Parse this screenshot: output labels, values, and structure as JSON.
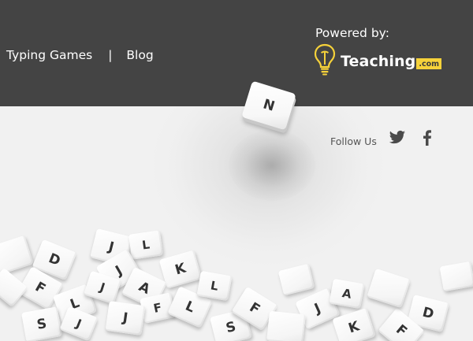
{
  "header": {
    "nav": {
      "typing_games": "Typing Games",
      "separator": "|",
      "blog": "Blog"
    },
    "powered_by": "Powered by:",
    "brand": {
      "name": "Teaching",
      "suffix": ".com",
      "icon": "lightbulb-icon"
    }
  },
  "flying_tile": "N",
  "follow": {
    "label": "Follow Us",
    "icons": [
      "twitter-icon",
      "facebook-icon"
    ]
  },
  "tiles": [
    {
      "letter": ""
    },
    {
      "letter": "D"
    },
    {
      "letter": "J"
    },
    {
      "letter": "L"
    },
    {
      "letter": "J"
    },
    {
      "letter": "K"
    },
    {
      "letter": "F"
    },
    {
      "letter": "L"
    },
    {
      "letter": "J"
    },
    {
      "letter": "A"
    },
    {
      "letter": "F"
    },
    {
      "letter": "S"
    },
    {
      "letter": "J"
    },
    {
      "letter": "L"
    },
    {
      "letter": "S"
    },
    {
      "letter": "F"
    },
    {
      "letter": "J"
    },
    {
      "letter": "A"
    },
    {
      "letter": "K"
    },
    {
      "letter": "D"
    },
    {
      "letter": "F"
    },
    {
      "letter": ""
    },
    {
      "letter": "L"
    },
    {
      "letter": ""
    },
    {
      "letter": "J"
    },
    {
      "letter": ""
    },
    {
      "letter": ""
    },
    {
      "letter": ""
    }
  ],
  "colors": {
    "header_bg": "#444444",
    "page_bg": "#ececec",
    "brand_accent": "#f6d23a",
    "text_light": "#ffffff",
    "text_dark": "#555555"
  }
}
